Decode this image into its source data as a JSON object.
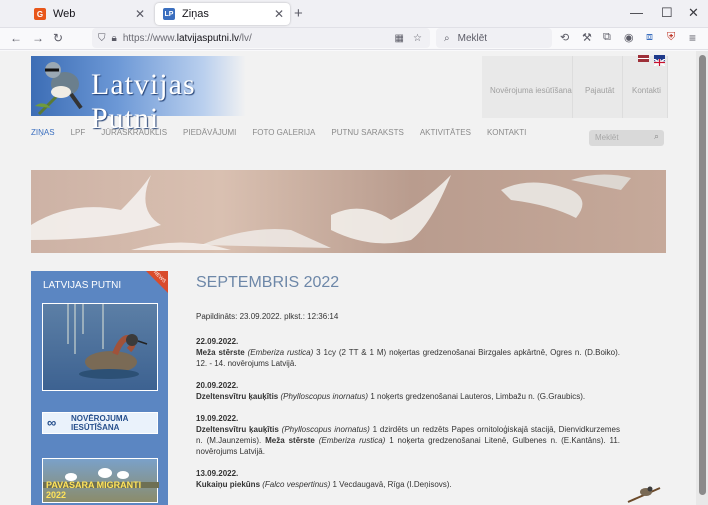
{
  "browser": {
    "tabs": [
      {
        "label": "Web",
        "favicon": "G",
        "favicon_color": "#e8561a"
      },
      {
        "label": "Ziņas",
        "favicon": "LP",
        "favicon_color": "#3b6fbf"
      }
    ],
    "url_scheme": "https://www.",
    "url_host": "latvijasputni.lv",
    "url_path": "/lv/",
    "search_placeholder": "Meklēt"
  },
  "site": {
    "logo_text": "Latvijas Putni",
    "top_links": [
      "Novērojuma iesūtīšana",
      "Pajautāt",
      "Kontakti"
    ],
    "nav": [
      "ZIŅAS",
      "LPF",
      "JŪRASKRAUKLIS",
      "PIEDĀVĀJUMI",
      "FOTO GALERIJA",
      "PUTNU SARAKSTS",
      "AKTIVITĀTES",
      "KONTAKTI"
    ],
    "search_placeholder": "Meklēt",
    "sidebar_title": "LATVIJAS PUTNI",
    "ribbon_label": "NEWS",
    "nov_button": "NOVĒROJUMA IESŪTĪŠANA",
    "migr_label": "PAVASARA MIGRANTI 2022"
  },
  "article": {
    "title": "SEPTEMBRIS 2022",
    "added": "Papildināts: 23.09.2022. plkst.: 12:36:14",
    "entries": [
      {
        "date": "22.09.2022.",
        "html": "<b>Meža stērste</b> <i>(Emberiza rustica)</i> 3 1cy (2 TT &amp; 1 M) noķertas gredzenošanai Birzgales apkārtnē, Ogres n. (D.Boiko). 12. - 14. novērojums Latvijā."
      },
      {
        "date": "20.09.2022.",
        "html": "<b>Dzeltensvītru ķauķītis</b> <i>(Phylloscopus inornatus)</i> 1 noķerts gredzenošanai Lauteros, Limbažu n. (G.Graubics)."
      },
      {
        "date": "19.09.2022.",
        "html": "<b>Dzeltensvītru ķauķītis</b> <i>(Phylloscopus inornatus)</i> 1 dzirdēts un redzēts Papes ornitoloģiskajā stacijā, Dienvidkurzemes n. (M.Jaunzemis). <b>Meža stērste</b> <i>(Emberiza rustica)</i> 1 noķerta gredzenošanai Litenē, Gulbenes n. (E.Kantāns). 11. novērojums Latvijā."
      },
      {
        "date": "13.09.2022.",
        "html": "<b>Kukaiņu piekūns</b> <i>(Falco vespertinus)</i> 1 Vecdaugavā, Rīga (I.Deņisovs)."
      }
    ]
  }
}
